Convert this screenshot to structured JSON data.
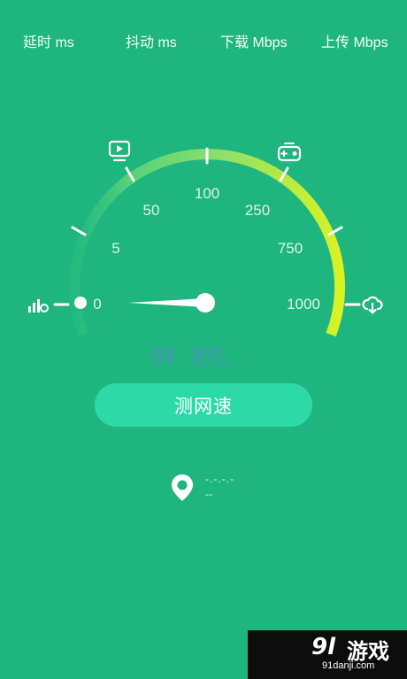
{
  "header": {
    "latency_label": "延时 ms",
    "jitter_label": "抖动 ms",
    "download_label": "下载 Mbps",
    "upload_label": "上传 Mbps"
  },
  "gauge": {
    "scale_labels": [
      "0",
      "5",
      "50",
      "100",
      "250",
      "750",
      "1000"
    ],
    "needle_value": "0",
    "colors": {
      "arc_start": "#37c97f",
      "arc_end": "#d8f225",
      "background": "#1fb57f"
    }
  },
  "icons": {
    "left": "signal-bars-icon",
    "top_left": "video-icon",
    "top_right": "gamepad-icon",
    "right": "cloud-download-icon",
    "location": "location-pin-icon"
  },
  "action": {
    "test_button_label": "测网速"
  },
  "location": {
    "line1": "-.-.-.-",
    "line2": "--"
  },
  "watermark": {
    "logo": "9l",
    "text": "游戏",
    "url": "91danji.com"
  }
}
